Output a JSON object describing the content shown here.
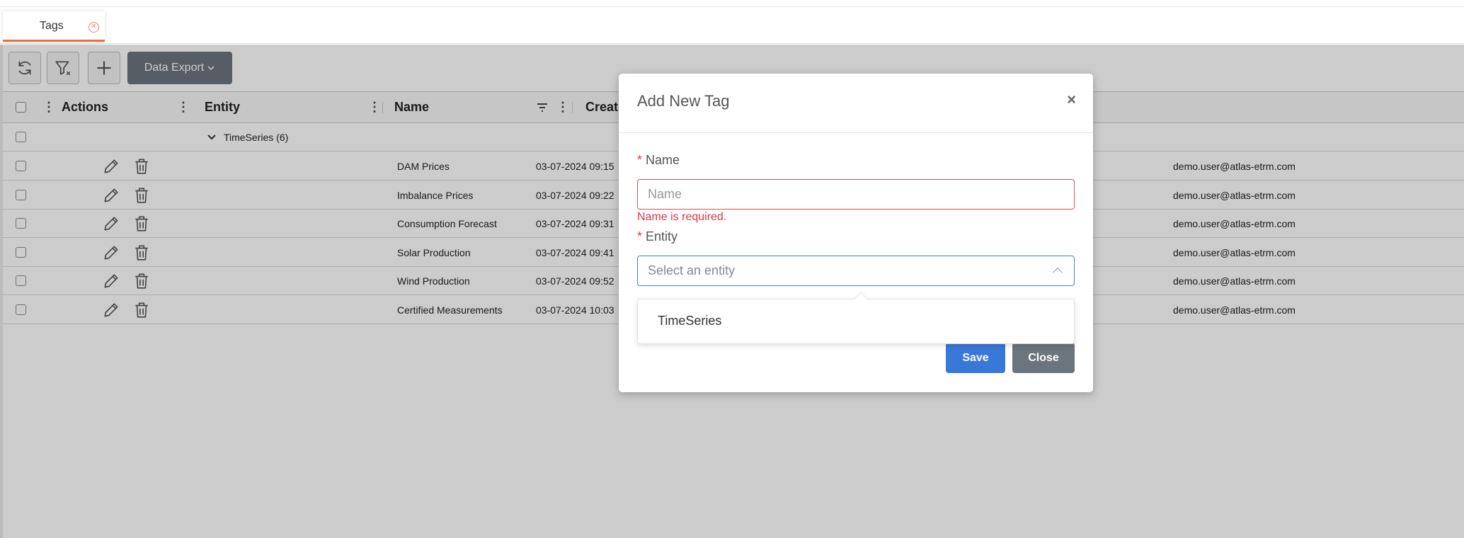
{
  "tabs": [
    {
      "label": "Tags",
      "close_icon": "close-circle-icon"
    }
  ],
  "toolbar": {
    "refresh_icon": "refresh-icon",
    "clear_filter_icon": "filter-clear-icon",
    "add_icon": "plus-icon",
    "export_label": "Data Export"
  },
  "grid": {
    "columns": {
      "actions": "Actions",
      "entity": "Entity",
      "name": "Name",
      "created": "Create"
    },
    "group": {
      "label": "TimeSeries (6)"
    },
    "rows": [
      {
        "name": "DAM Prices",
        "created": "03-07-2024 09:15",
        "user": "demo.user@atlas-etrm.com"
      },
      {
        "name": "Imbalance Prices",
        "created": "03-07-2024 09:22",
        "user": "demo.user@atlas-etrm.com"
      },
      {
        "name": "Consumption Forecast",
        "created": "03-07-2024 09:31",
        "user": "demo.user@atlas-etrm.com"
      },
      {
        "name": "Solar Production",
        "created": "03-07-2024 09:41",
        "user": "demo.user@atlas-etrm.com"
      },
      {
        "name": "Wind Production",
        "created": "03-07-2024 09:52",
        "user": "demo.user@atlas-etrm.com"
      },
      {
        "name": "Certified Measurements",
        "created": "03-07-2024 10:03",
        "user": "demo.user@atlas-etrm.com"
      }
    ]
  },
  "modal": {
    "title": "Add New Tag",
    "close_glyph": "×",
    "required_mark": "*",
    "name_label": "Name",
    "name_placeholder": "Name",
    "name_error": "Name is required.",
    "entity_label": "Entity",
    "entity_placeholder": "Select an entity",
    "entity_options": [
      "TimeSeries"
    ],
    "save_label": "Save",
    "close_label": "Close"
  }
}
